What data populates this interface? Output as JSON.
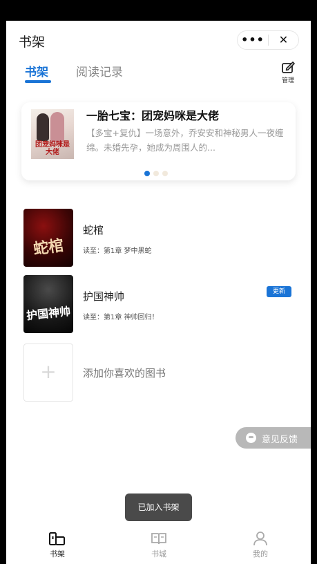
{
  "header": {
    "title": "书架",
    "more_glyph": "•••",
    "close_glyph": "✕"
  },
  "tabs": [
    {
      "label": "书架",
      "active": true
    },
    {
      "label": "阅读记录",
      "active": false
    }
  ],
  "manage": {
    "label": "管理",
    "icon": "edit-icon"
  },
  "banner": {
    "title": "一胎七宝：团宠妈咪是大佬",
    "description": "【多宝+复仇】一场意外，乔安安和神秘男人一夜缠绵。未婚先孕，她成为周围人的...",
    "cover_text": "团宠妈咪是大佬",
    "dots": 3,
    "active_dot": 0
  },
  "books": [
    {
      "title": "蛇棺",
      "progress": "读至：第1章 梦中黑蛇",
      "cover_text": "蛇棺",
      "badge": ""
    },
    {
      "title": "护国神帅",
      "progress": "读至：第1章 神帅回归！",
      "cover_text": "护国神帅",
      "badge": "更新"
    }
  ],
  "add_book": {
    "label": "添加你喜欢的图书",
    "icon": "plus-icon"
  },
  "feedback": {
    "label": "意见反馈"
  },
  "toast": {
    "text": "已加入书架"
  },
  "bottom_nav": [
    {
      "label": "书架",
      "icon": "bookshelf-icon",
      "active": true
    },
    {
      "label": "书城",
      "icon": "book-open-icon",
      "active": false
    },
    {
      "label": "我的",
      "icon": "user-icon",
      "active": false
    }
  ],
  "colors": {
    "accent": "#1a74d6",
    "background": "#ffffff",
    "muted": "#999999"
  }
}
